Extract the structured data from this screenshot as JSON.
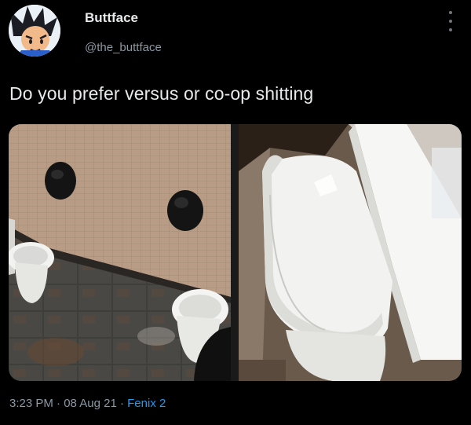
{
  "author": {
    "display_name": "Buttface",
    "handle": "@the_buttface"
  },
  "tweet": {
    "text": "Do you prefer versus or co-op shitting"
  },
  "meta": {
    "time": "3:23 PM",
    "date": "08 Aug 21",
    "separator": "·",
    "source": "Fenix 2"
  },
  "colors": {
    "background": "#000000",
    "text": "#e7e9ea",
    "secondary": "#8b98a5",
    "link": "#1d9bf0"
  },
  "icons": {
    "more": "more-vertical-icon",
    "avatar": "cartoon-avatar-icon"
  }
}
